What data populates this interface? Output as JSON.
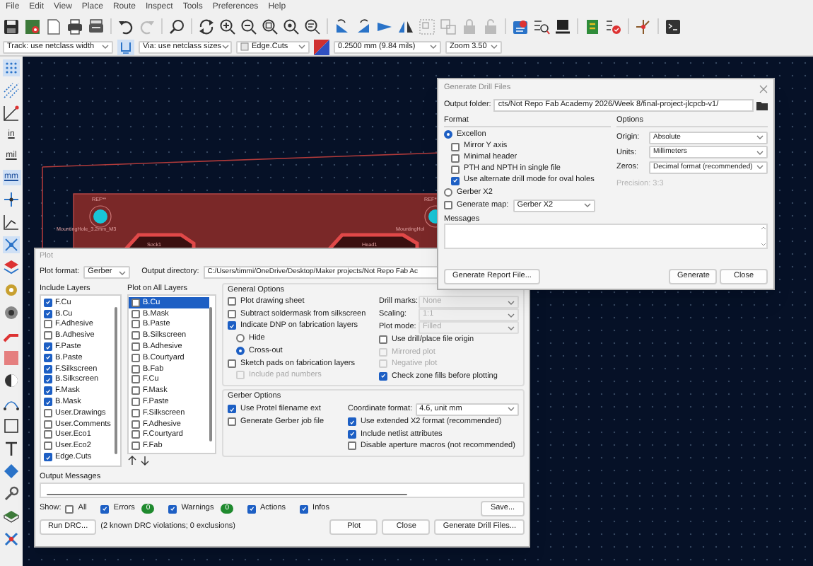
{
  "menu": [
    "File",
    "Edit",
    "View",
    "Place",
    "Route",
    "Inspect",
    "Tools",
    "Preferences",
    "Help"
  ],
  "toolbar": {
    "track": "Track: use netclass width",
    "via": "Via: use netclass sizes",
    "layer": "Edge.Cuts",
    "grid": "0.2500 mm (9.84 mils)",
    "zoom": "Zoom 3.50"
  },
  "units": [
    {
      "label": "in",
      "selected": false
    },
    {
      "label": "mil",
      "selected": false
    },
    {
      "label": "mm",
      "selected": true
    }
  ],
  "canvas_labels": [
    {
      "text": "REF**"
    },
    {
      "text": "REF**"
    },
    {
      "text": "MountingHole_3.2mm_M3"
    },
    {
      "text": "Sock1"
    },
    {
      "text": "Head1"
    },
    {
      "text": "MountingHol"
    }
  ],
  "drill_dialog": {
    "title": "Generate Drill Files",
    "output_folder_label": "Output folder:",
    "output_folder": "cts/Not Repo Fab Academy 2026/Week 8/final-project-jlcpcb-v1/",
    "format_label": "Format",
    "formats": [
      {
        "label": "Excellon",
        "selected": true
      },
      {
        "label": "Gerber X2",
        "selected": false
      }
    ],
    "excellon_options": [
      {
        "label": "Mirror Y axis",
        "checked": false
      },
      {
        "label": "Minimal header",
        "checked": false
      },
      {
        "label": "PTH and NPTH in single file",
        "checked": false
      },
      {
        "label": "Use alternate drill mode for oval holes",
        "checked": true
      }
    ],
    "generate_map": {
      "label": "Generate map:",
      "checked": false,
      "value": "Gerber X2"
    },
    "options_label": "Options",
    "options": [
      {
        "label": "Origin:",
        "value": "Absolute"
      },
      {
        "label": "Units:",
        "value": "Millimeters"
      },
      {
        "label": "Zeros:",
        "value": "Decimal format (recommended)"
      }
    ],
    "precision": "Precision: 3:3",
    "messages_label": "Messages",
    "report_button": "Generate Report File...",
    "buttons": [
      "Generate",
      "Close"
    ]
  },
  "plot_dialog": {
    "title": "Plot",
    "format_label": "Plot format:",
    "format": "Gerber",
    "output_dir_label": "Output directory:",
    "output_dir": "C:/Users/timmi/OneDrive/Desktop/Maker projects/Not Repo Fab Ac",
    "include_layers_label": "Include Layers",
    "include_layers": [
      {
        "name": "F.Cu",
        "checked": true
      },
      {
        "name": "B.Cu",
        "checked": true
      },
      {
        "name": "F.Adhesive",
        "checked": false
      },
      {
        "name": "B.Adhesive",
        "checked": false
      },
      {
        "name": "F.Paste",
        "checked": true
      },
      {
        "name": "B.Paste",
        "checked": true
      },
      {
        "name": "F.Silkscreen",
        "checked": true
      },
      {
        "name": "B.Silkscreen",
        "checked": true
      },
      {
        "name": "F.Mask",
        "checked": true
      },
      {
        "name": "B.Mask",
        "checked": true
      },
      {
        "name": "User.Drawings",
        "checked": false
      },
      {
        "name": "User.Comments",
        "checked": false
      },
      {
        "name": "User.Eco1",
        "checked": false
      },
      {
        "name": "User.Eco2",
        "checked": false
      },
      {
        "name": "Edge.Cuts",
        "checked": true
      }
    ],
    "all_layers_label": "Plot on All Layers",
    "all_layers": [
      {
        "name": "B.Cu",
        "checked": false,
        "selected": true
      },
      {
        "name": "B.Mask",
        "checked": false,
        "selected": false
      },
      {
        "name": "B.Paste",
        "checked": false,
        "selected": false
      },
      {
        "name": "B.Silkscreen",
        "checked": false,
        "selected": false
      },
      {
        "name": "B.Adhesive",
        "checked": false,
        "selected": false
      },
      {
        "name": "B.Courtyard",
        "checked": false,
        "selected": false
      },
      {
        "name": "B.Fab",
        "checked": false,
        "selected": false
      },
      {
        "name": "F.Cu",
        "checked": false,
        "selected": false
      },
      {
        "name": "F.Mask",
        "checked": false,
        "selected": false
      },
      {
        "name": "F.Paste",
        "checked": false,
        "selected": false
      },
      {
        "name": "F.Silkscreen",
        "checked": false,
        "selected": false
      },
      {
        "name": "F.Adhesive",
        "checked": false,
        "selected": false
      },
      {
        "name": "F.Courtyard",
        "checked": false,
        "selected": false
      },
      {
        "name": "F.Fab",
        "checked": false,
        "selected": false
      }
    ],
    "general_label": "General Options",
    "general_top": [
      {
        "label": "Plot drawing sheet",
        "checked": false
      },
      {
        "label": "Subtract soldermask from silkscreen",
        "checked": false
      },
      {
        "label": "Indicate DNP on fabrication layers",
        "checked": true
      }
    ],
    "dnp_modes": [
      {
        "label": "Hide",
        "selected": false
      },
      {
        "label": "Cross-out",
        "selected": true
      }
    ],
    "general_bottom": [
      {
        "label": "Sketch pads on fabrication layers",
        "checked": false,
        "disabled": false
      },
      {
        "label": "Include pad numbers",
        "checked": false,
        "disabled": true
      }
    ],
    "general_dropdowns": [
      {
        "label": "Drill marks:",
        "value": "None"
      },
      {
        "label": "Scaling:",
        "value": "1:1"
      },
      {
        "label": "Plot mode:",
        "value": "Filled"
      }
    ],
    "general_right": [
      {
        "label": "Use drill/place file origin",
        "checked": false,
        "disabled": false
      },
      {
        "label": "Mirrored plot",
        "checked": false,
        "disabled": true
      },
      {
        "label": "Negative plot",
        "checked": false,
        "disabled": true
      },
      {
        "label": "Check zone fills before plotting",
        "checked": true,
        "disabled": false
      }
    ],
    "gerber_label": "Gerber Options",
    "gerber_left": [
      {
        "label": "Use Protel filename ext",
        "checked": true
      },
      {
        "label": "Generate Gerber job file",
        "checked": false
      }
    ],
    "coordinate_format": {
      "label": "Coordinate format:",
      "value": "4.6, unit mm"
    },
    "gerber_right": [
      {
        "label": "Use extended X2 format (recommended)",
        "checked": true
      },
      {
        "label": "Include netlist attributes",
        "checked": true
      },
      {
        "label": "Disable aperture macros (not recommended)",
        "checked": false
      }
    ],
    "output_messages_label": "Output Messages",
    "show_label": "Show:",
    "filters": [
      {
        "label": "All",
        "checked": false
      },
      {
        "label": "Errors",
        "checked": true,
        "count": "0"
      },
      {
        "label": "Warnings",
        "checked": true,
        "count": "0"
      },
      {
        "label": "Actions",
        "checked": true
      },
      {
        "label": "Infos",
        "checked": true
      }
    ],
    "save_button": "Save...",
    "run_drc_button": "Run DRC...",
    "drc_status": "(2 known DRC violations; 0 exclusions)",
    "buttons": [
      "Plot",
      "Close",
      "Generate Drill Files..."
    ]
  }
}
